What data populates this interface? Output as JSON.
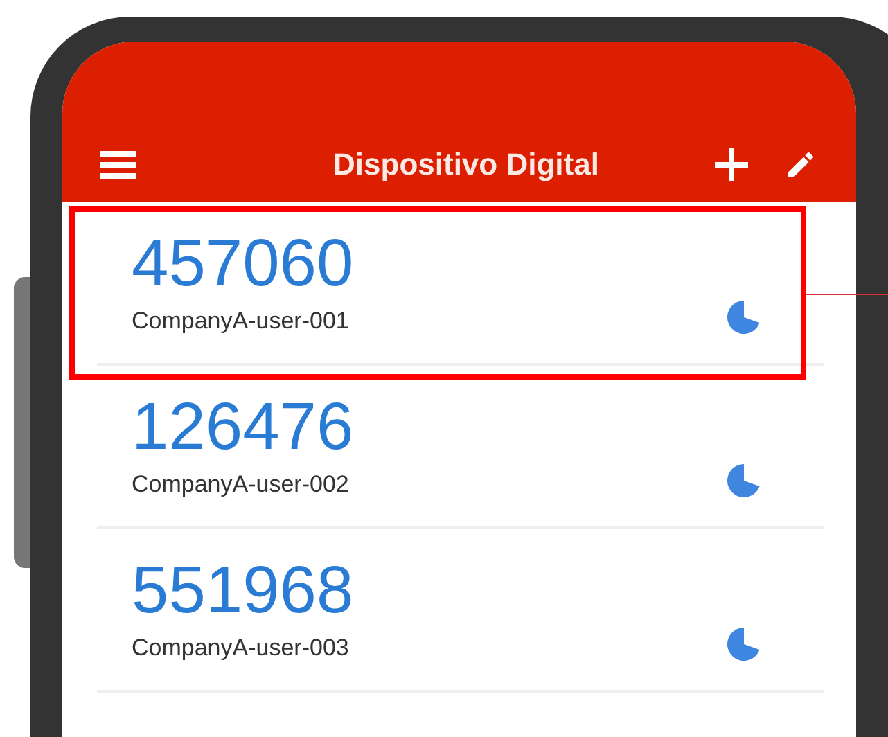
{
  "header": {
    "title": "Dispositivo Digital"
  },
  "accounts": [
    {
      "code": "457060",
      "name": "CompanyA-user-001",
      "highlighted": true
    },
    {
      "code": "126476",
      "name": "CompanyA-user-002",
      "highlighted": false
    },
    {
      "code": "551968",
      "name": "CompanyA-user-003",
      "highlighted": false
    }
  ]
}
